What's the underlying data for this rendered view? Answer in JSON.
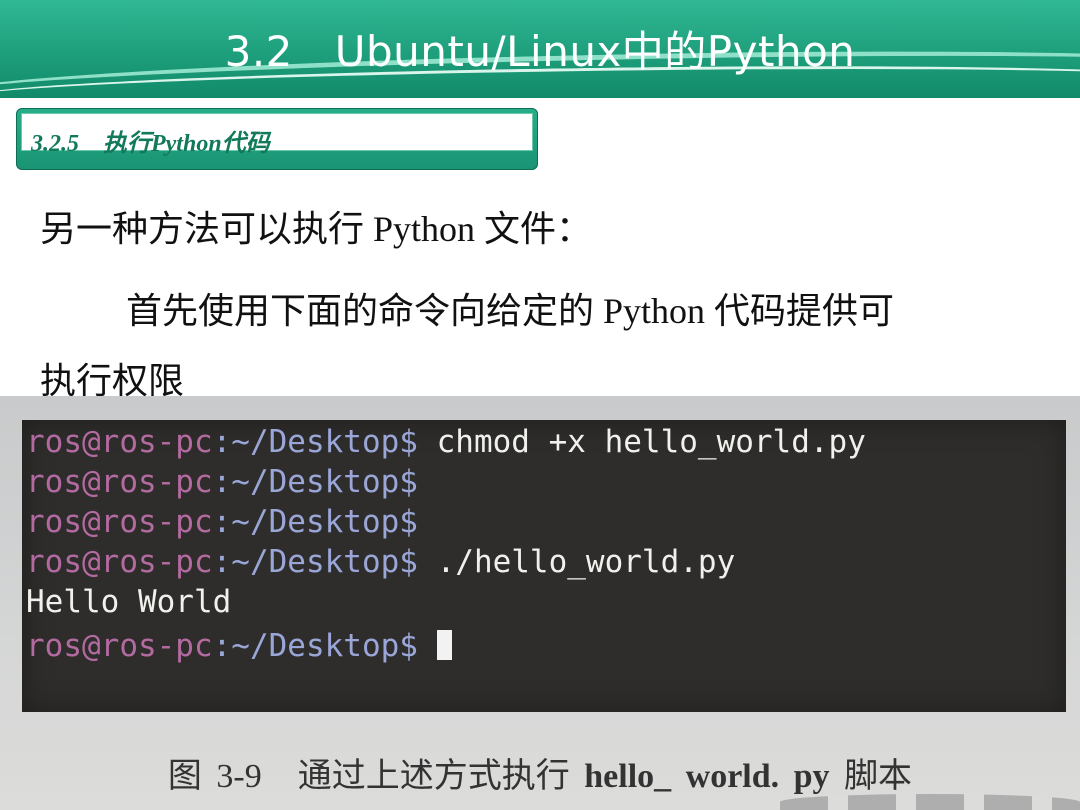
{
  "header": {
    "title": "3.2 Ubuntu/Linux中的Python"
  },
  "section": {
    "number": "3.2.5",
    "title": "执行Python代码"
  },
  "body": {
    "line1": "另一种方法可以执行 Python 文件：",
    "line2": "首先使用下面的命令向给定的 Python 代码提供可",
    "line3": "执行权限"
  },
  "terminal": {
    "prompt_user": "ros@ros-pc",
    "prompt_path": ":~/Desktop$",
    "lines": [
      {
        "command": " chmod +x hello_world.py"
      },
      {
        "command": ""
      },
      {
        "command": ""
      },
      {
        "command": " ./hello_world.py"
      }
    ],
    "output": "Hello World",
    "final_prompt_command": " "
  },
  "caption": {
    "figure": "图 3-9",
    "text_before": "通过上述方式执行",
    "file": "hello_ world. py",
    "text_after": "脚本"
  },
  "colors": {
    "header_green": "#1e9f7c",
    "section_text": "#12795b",
    "terminal_bg": "#2e2d2b",
    "prompt_user": "#b36aa0",
    "prompt_path": "#9aa6d8"
  }
}
